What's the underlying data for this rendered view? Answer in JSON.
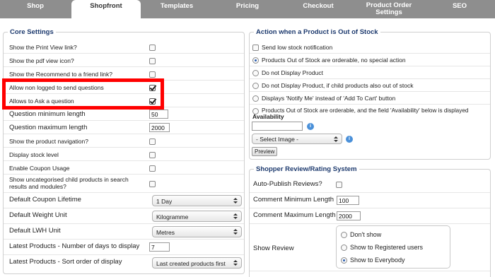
{
  "tabs": [
    {
      "label": "Shop"
    },
    {
      "label": "Shopfront"
    },
    {
      "label": "Templates"
    },
    {
      "label": "Pricing"
    },
    {
      "label": "Checkout"
    },
    {
      "label": "Product Order Settings"
    },
    {
      "label": "SEO"
    }
  ],
  "core": {
    "legend": "Core Settings",
    "print_view": "Show the Print View link?",
    "pdf_icon": "Show the pdf view icon?",
    "recommend": "Show the Recommend to a friend link?",
    "non_logged": "Allow non logged to send questions",
    "ask_question": "Allows to Ask a question",
    "q_min": "Question minimum length",
    "q_min_val": "50",
    "q_max": "Question maximum length",
    "q_max_val": "2000",
    "prod_nav": "Show the product navigation?",
    "stock_level": "Display stock level",
    "coupon": "Enable Coupon Usage",
    "uncategorised": "Show uncategorised child products in search results and modules?",
    "coupon_lifetime": "Default Coupon Lifetime",
    "coupon_lifetime_val": "1 Day",
    "weight_unit": "Default Weight Unit",
    "weight_unit_val": "Kilogramme",
    "lwh_unit": "Default LWH Unit",
    "lwh_unit_val": "Metres",
    "latest_days": "Latest Products - Number of days to display",
    "latest_days_val": "7",
    "latest_sort": "Latest Products - Sort order of display",
    "latest_sort_val": "Last created products first"
  },
  "stock": {
    "legend": "Action when a Product is Out of Stock",
    "low_stock": "Send low stock notification",
    "opt1": "Products Out of Stock are orderable, no special action",
    "opt2": "Do not Display Product",
    "opt3": "Do not Display Product, if child products also out of stock",
    "opt4": "Displays 'Notify Me' instead of 'Add To Cart' button",
    "opt5": "Products Out of Stock are orderable, and the field 'Availability' below is displayed",
    "availability": "Availability",
    "info": "i",
    "select_image": "- Select Image -",
    "preview": "Preview"
  },
  "review": {
    "legend": "Shopper Review/Rating System",
    "auto_publish": "Auto-Publish Reviews?",
    "comment_min": "Comment Minimum Length",
    "comment_min_val": "100",
    "comment_max": "Comment Maximum Length",
    "comment_max_val": "2000",
    "show_review": "Show Review",
    "opt_dont": "Don't show",
    "opt_registered": "Show to Registered users",
    "opt_everybody": "Show to Everybody"
  }
}
